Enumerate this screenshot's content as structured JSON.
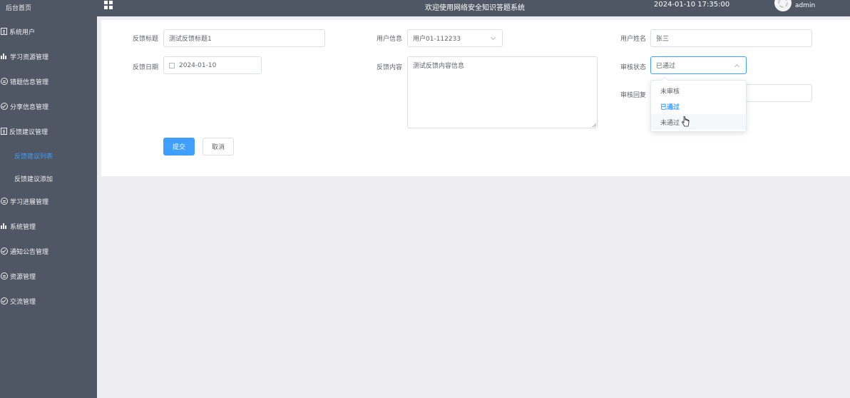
{
  "sidebar": {
    "home": "后台首页",
    "items": [
      {
        "label": "系统用户",
        "icon": "list-icon"
      },
      {
        "label": "学习资源管理",
        "icon": "bar-chart-icon"
      },
      {
        "label": "错题信息管理",
        "icon": "chat-icon"
      },
      {
        "label": "分享信息管理",
        "icon": "check-circle-icon"
      },
      {
        "label": "反馈建议管理",
        "icon": "list-icon"
      },
      {
        "label": "学习进展管理",
        "icon": "chat-icon"
      },
      {
        "label": "系统管理",
        "icon": "bar-chart-icon"
      },
      {
        "label": "通知公告管理",
        "icon": "check-circle-icon"
      },
      {
        "label": "资源管理",
        "icon": "chat-icon"
      },
      {
        "label": "交流管理",
        "icon": "check-circle-icon"
      }
    ],
    "sub_items": [
      "反馈建议列表",
      "反馈建议添加"
    ]
  },
  "header": {
    "title": "欢迎使用网络安全知识答题系统",
    "datetime": "2024-01-10 17:35:00",
    "user": "admin"
  },
  "form": {
    "title_label": "反馈标题",
    "title_value": "测试反馈标题1",
    "user_info_label": "用户信息",
    "user_info_value": "用户01-112233",
    "user_name_label": "用户姓名",
    "user_name_value": "张三",
    "date_label": "反馈日期",
    "date_value": "2024-01-10",
    "content_label": "反馈内容",
    "content_value": "测试反馈内容信息",
    "status_label": "审核状态",
    "status_value": "已通过",
    "reply_label": "审核回复",
    "submit_label": "提交",
    "cancel_label": "取消"
  },
  "status_options": [
    "未审核",
    "已通过",
    "未通过"
  ],
  "colors": {
    "sidebar": "#4f5764",
    "accent": "#409eff",
    "background": "#eeeef2"
  }
}
